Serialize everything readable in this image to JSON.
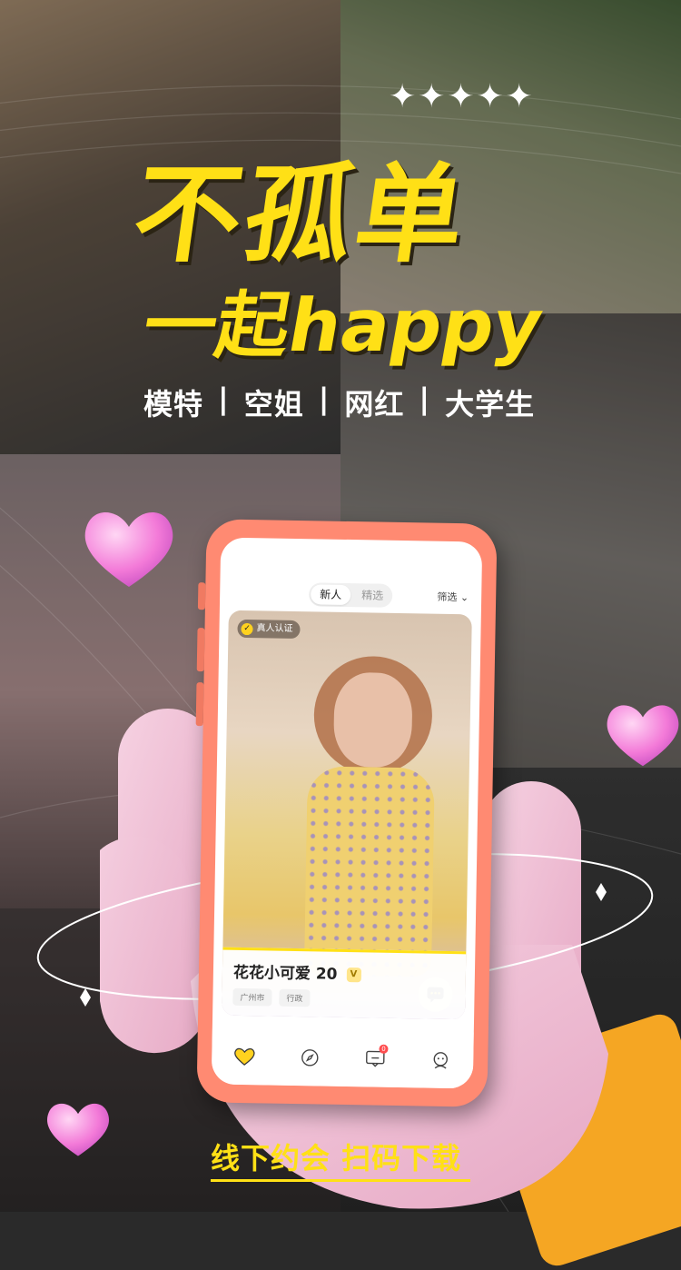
{
  "hero": {
    "stars": "✦✦✦✦✦",
    "title_line1": "不孤单",
    "title_line2": "一起happy",
    "tags": [
      "模特",
      "空姐",
      "网红",
      "大学生"
    ],
    "separator": "|"
  },
  "app": {
    "tabs": [
      {
        "label": "新人",
        "active": true
      },
      {
        "label": "精选",
        "active": false
      }
    ],
    "filter_label": "筛选",
    "verified_badge": "真人认证",
    "profile": {
      "name": "花花小可爱",
      "age": "20",
      "vip_mark": "V",
      "chips": [
        "广州市",
        "行政"
      ]
    },
    "nav": {
      "items": [
        "home-heart-icon",
        "discover-compass-icon",
        "messages-icon",
        "profile-icon"
      ],
      "message_badge": "0"
    }
  },
  "cta": {
    "text": "线下约会 扫码下载"
  },
  "colors": {
    "accent": "#ffe016",
    "phone_shell": "#ff8a72",
    "sleeve": "#f5a623"
  }
}
